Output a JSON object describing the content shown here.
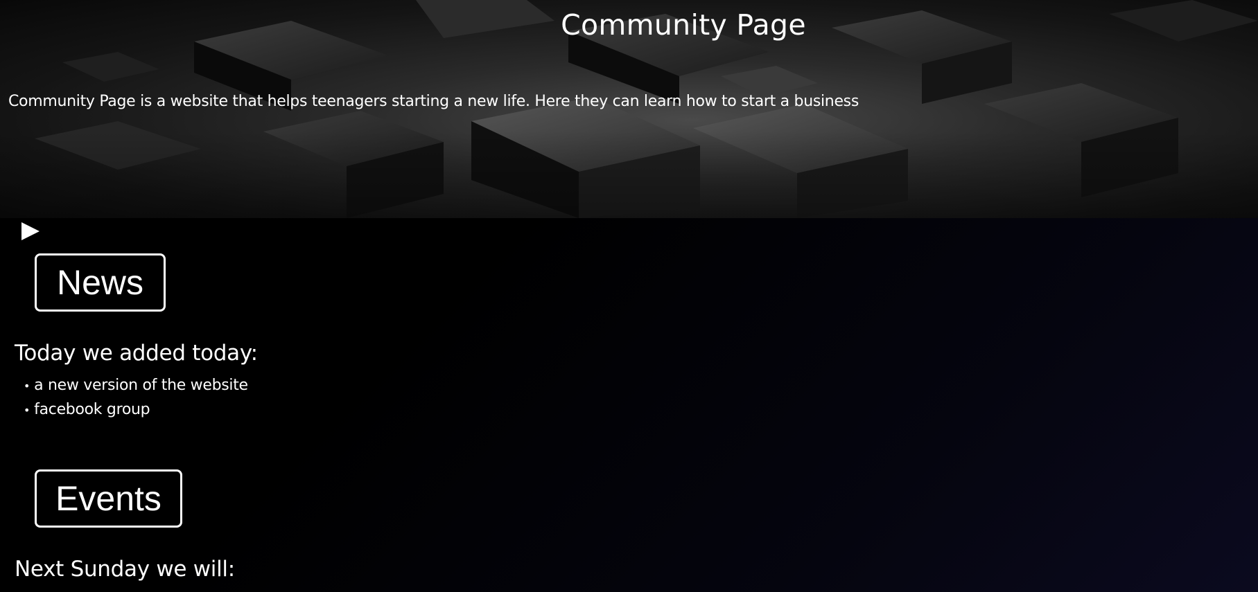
{
  "header": {
    "title": "Community Page",
    "intro": "Community Page is a website that helps teenagers starting a new life. Here they can learn how to start a business"
  },
  "toggle_icon": "play-triangle-icon",
  "news": {
    "button_label": "News",
    "heading": "Today we added today:",
    "items": [
      "a new version of the website",
      "facebook group"
    ]
  },
  "events": {
    "button_label": "Events",
    "heading": "Next Sunday we will:"
  },
  "colors": {
    "background": "#000000",
    "text": "#ffffff",
    "button_border": "#ffffff"
  }
}
